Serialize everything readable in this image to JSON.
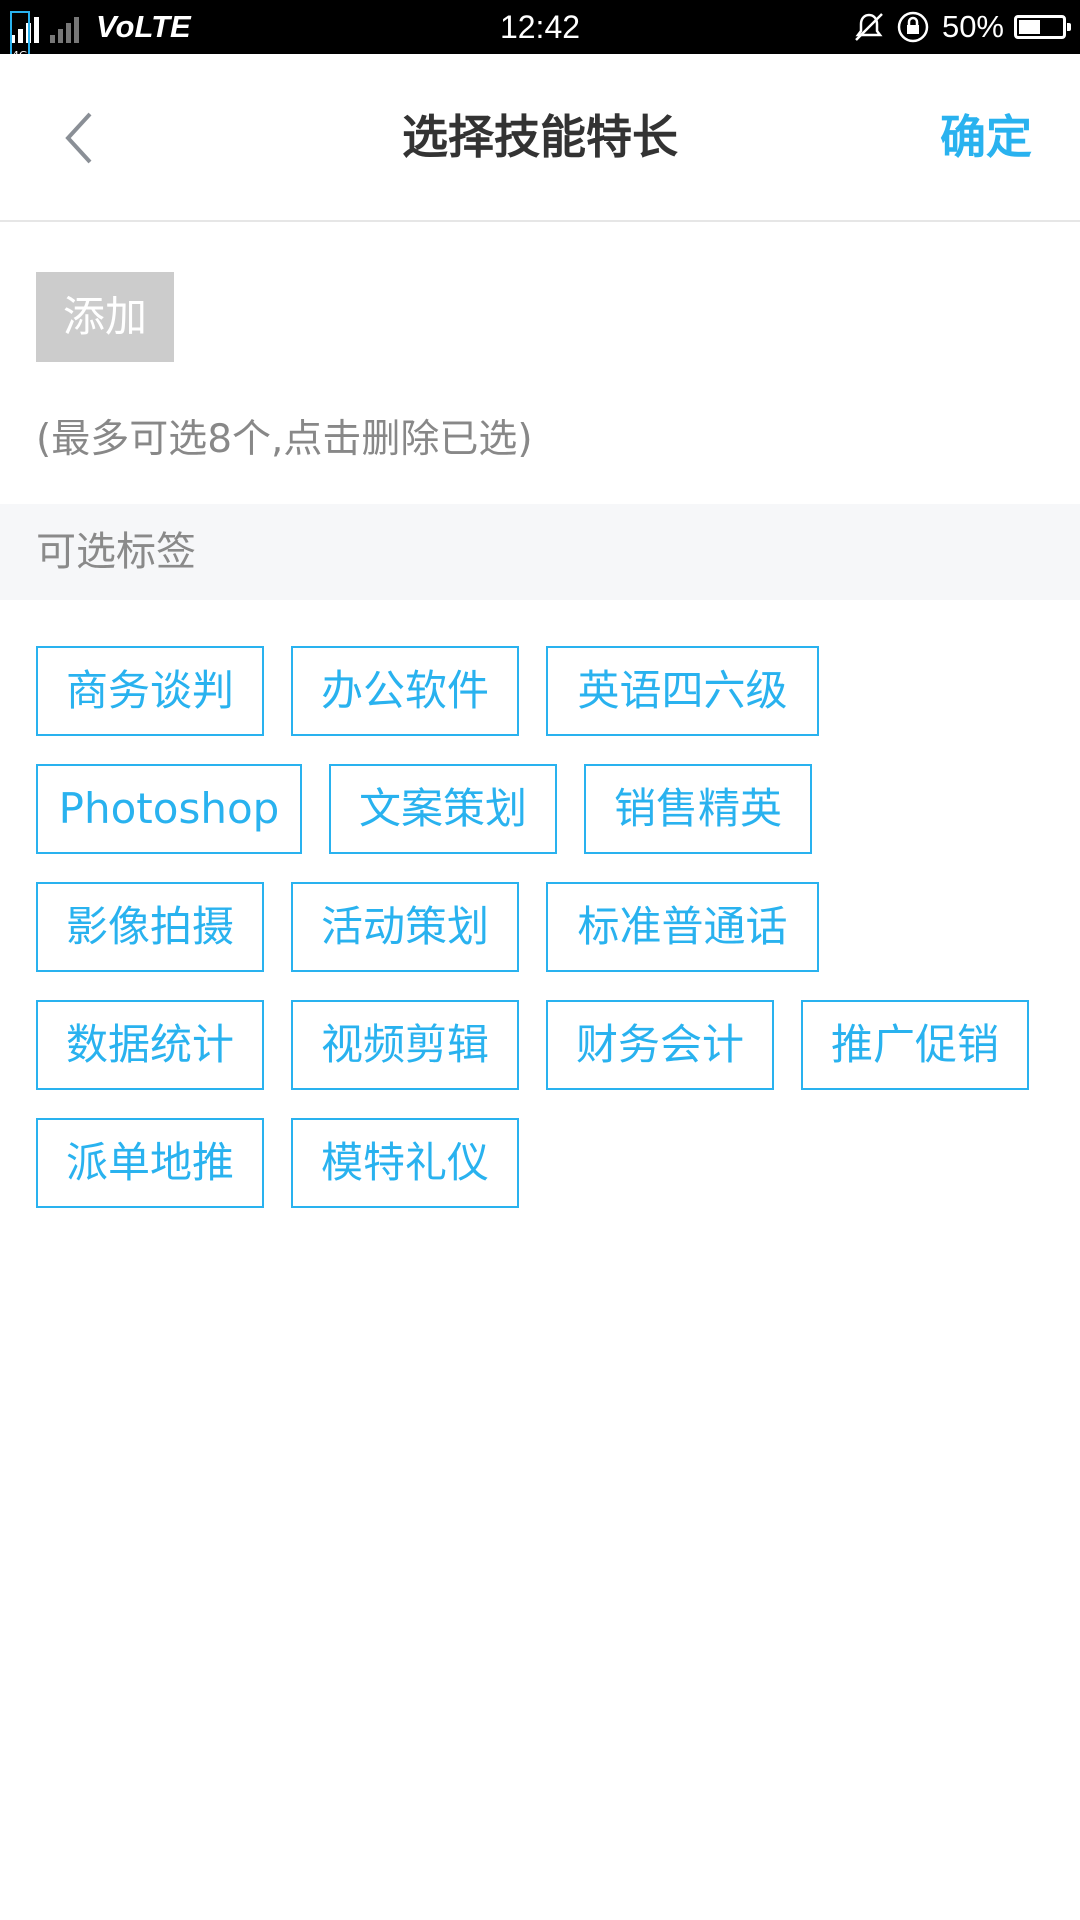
{
  "status_bar": {
    "network": "4G",
    "volte": "VoLTE",
    "time": "12:42",
    "battery_percent": "50%",
    "battery_level": 0.5,
    "icons": [
      "signal-icon",
      "mute-vibrate-icon",
      "rotation-lock-icon",
      "battery-icon"
    ]
  },
  "header": {
    "title": "选择技能特长",
    "confirm_label": "确定"
  },
  "add_button_label": "添加",
  "hint": "(最多可选8个,点击删除已选)",
  "section_title": "可选标签",
  "tags": [
    "商务谈判",
    "办公软件",
    "英语四六级",
    "Photoshop",
    "文案策划",
    "销售精英",
    "影像拍摄",
    "活动策划",
    "标准普通话",
    "数据统计",
    "视频剪辑",
    "财务会计",
    "推广促销",
    "派单地推",
    "模特礼仪"
  ],
  "colors": {
    "accent": "#29b2ef",
    "title_text": "#333333",
    "add_button_bg": "#cccccc",
    "section_bg": "#f6f7f9"
  }
}
